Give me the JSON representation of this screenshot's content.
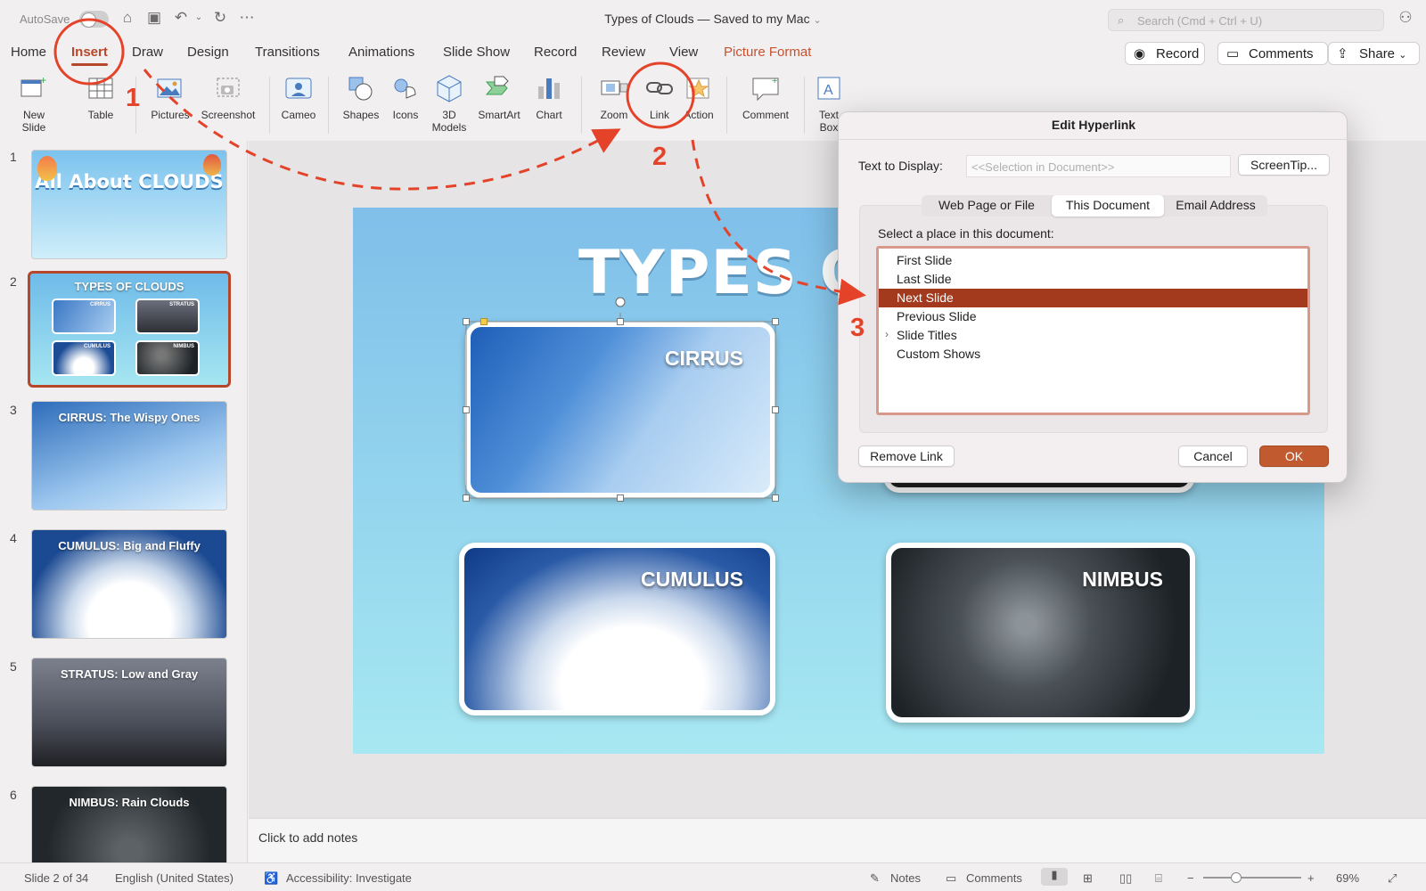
{
  "titlebar": {
    "autosave_label": "AutoSave",
    "doc_title": "Types of Clouds — Saved to my Mac",
    "search_placeholder": "Search (Cmd + Ctrl + U)",
    "icons": [
      "home-icon",
      "save-icon",
      "undo-icon",
      "redo-icon",
      "more-icon",
      "share-people-icon"
    ]
  },
  "tabs": [
    "Home",
    "Insert",
    "Draw",
    "Design",
    "Transitions",
    "Animations",
    "Slide Show",
    "Record",
    "Review",
    "View",
    "Picture Format"
  ],
  "active_tab": "Insert",
  "tab_buttons": {
    "record": "Record",
    "comments": "Comments",
    "share": "Share"
  },
  "ribbon": {
    "new_slide": [
      "New",
      "Slide"
    ],
    "table": "Table",
    "pictures": "Pictures",
    "screenshot": "Screenshot",
    "cameo": "Cameo",
    "shapes": "Shapes",
    "icons": "Icons",
    "models": [
      "3D",
      "Models"
    ],
    "smartart": "SmartArt",
    "chart": "Chart",
    "zoom": "Zoom",
    "link": "Link",
    "action": "Action",
    "comment": "Comment",
    "textbox": [
      "Text",
      "Box"
    ]
  },
  "thumbnails": [
    {
      "num": "1",
      "caption": "All About CLOUDS"
    },
    {
      "num": "2",
      "caption": "TYPES OF CLOUDS"
    },
    {
      "num": "3",
      "caption": "CIRRUS: The Wispy Ones"
    },
    {
      "num": "4",
      "caption": "CUMULUS: Big and Fluffy"
    },
    {
      "num": "5",
      "caption": "STRATUS: Low and Gray"
    },
    {
      "num": "6",
      "caption": "NIMBUS: Rain Clouds"
    }
  ],
  "thumb_minis": [
    "CIRRUS",
    "STRATUS",
    "CUMULUS",
    "NIMBUS"
  ],
  "slide": {
    "title": "TYPES OF",
    "cards": [
      "CIRRUS",
      "CUMULUS",
      "NIMBUS"
    ]
  },
  "notes_placeholder": "Click to add notes",
  "status": {
    "slide_count": "Slide 2 of 34",
    "language": "English (United States)",
    "accessibility": "Accessibility: Investigate",
    "notes": "Notes",
    "comments": "Comments",
    "zoom": "69%"
  },
  "dialog": {
    "title": "Edit Hyperlink",
    "text_to_display_label": "Text to Display:",
    "text_to_display_placeholder": "<<Selection in Document>>",
    "screentip": "ScreenTip...",
    "tabs": [
      "Web Page or File",
      "This Document",
      "Email Address"
    ],
    "selected_tab": "This Document",
    "list_label": "Select a place in this document:",
    "places": [
      "First Slide",
      "Last Slide",
      "Next Slide",
      "Previous Slide",
      "Slide Titles",
      "Custom Shows"
    ],
    "selected_place": "Next Slide",
    "remove_link": "Remove Link",
    "cancel": "Cancel",
    "ok": "OK"
  },
  "annotations": {
    "step1": "1",
    "step2": "2",
    "step3": "3",
    "accent_color": "#e4432a"
  },
  "colors": {
    "accent": "#b7472a",
    "ok_button": "#c25a2f",
    "selection": "#a43a1d"
  }
}
